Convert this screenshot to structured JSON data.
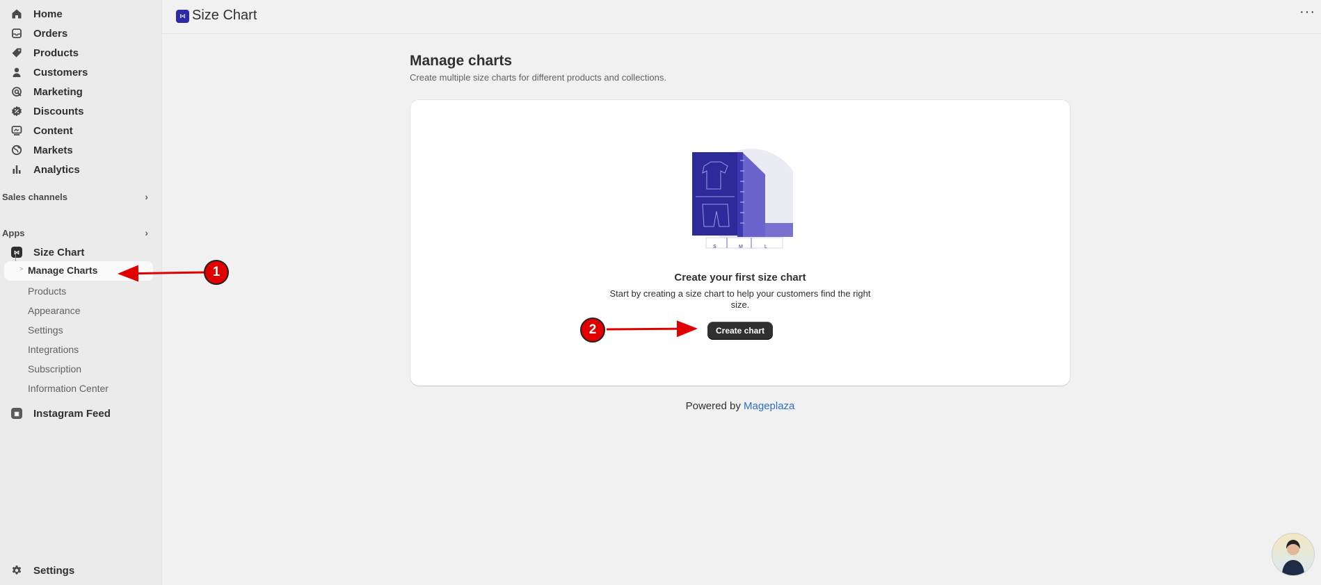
{
  "sidebar": {
    "nav": [
      {
        "label": "Home",
        "icon": "home-icon"
      },
      {
        "label": "Orders",
        "icon": "inbox-icon"
      },
      {
        "label": "Products",
        "icon": "tag-icon"
      },
      {
        "label": "Customers",
        "icon": "person-icon"
      },
      {
        "label": "Marketing",
        "icon": "target-icon"
      },
      {
        "label": "Discounts",
        "icon": "discount-icon"
      },
      {
        "label": "Content",
        "icon": "monitor-icon"
      },
      {
        "label": "Markets",
        "icon": "globe-icon"
      },
      {
        "label": "Analytics",
        "icon": "bar-chart-icon"
      }
    ],
    "sales_channels_label": "Sales channels",
    "apps_label": "Apps",
    "size_chart_app": "Size Chart",
    "size_chart_subitems": {
      "active": "Manage Charts",
      "others": [
        "Products",
        "Appearance",
        "Settings",
        "Integrations",
        "Subscription",
        "Information Center"
      ]
    },
    "instagram_app": "Instagram Feed",
    "settings_label": "Settings"
  },
  "topbar": {
    "title": "Size Chart",
    "menu_glyph": "···"
  },
  "main": {
    "title": "Manage charts",
    "subtitle": "Create multiple size charts for different products and collections.",
    "empty_state": {
      "title": "Create your first size chart",
      "description": "Start by creating a size chart to help your customers find the right size.",
      "button_label": "Create chart",
      "illustration_sizes": [
        "S",
        "M",
        "L"
      ]
    },
    "footer": {
      "prefix": "Powered by",
      "link": "Mageplaza"
    }
  },
  "annotations": [
    {
      "number": "1"
    },
    {
      "number": "2"
    }
  ],
  "colors": {
    "brand": "#2c2aa6",
    "annotation": "#e00000",
    "link": "#2c6ecb"
  }
}
